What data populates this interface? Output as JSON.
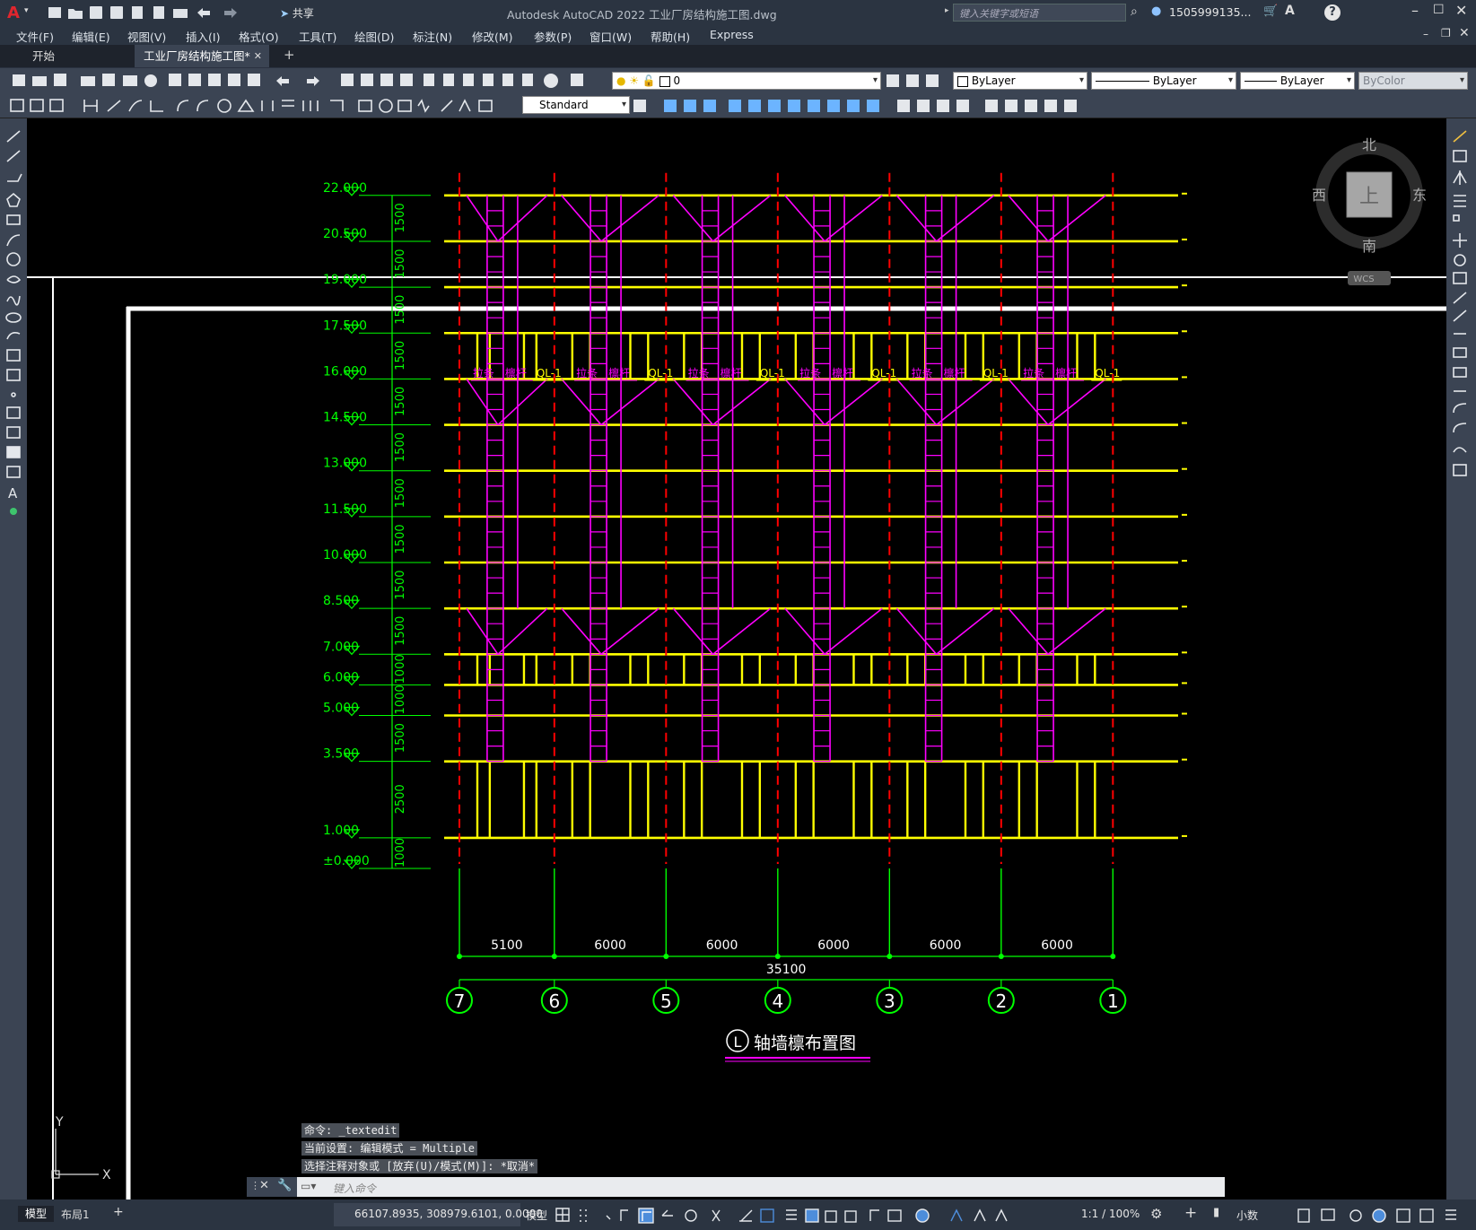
{
  "window": {
    "title": "Autodesk AutoCAD 2022    工业厂房结构施工图.dwg",
    "share_label": "共享",
    "search_placeholder": "键入关键字或短语",
    "user": "1505999135...",
    "help": "?"
  },
  "menu": [
    "文件(F)",
    "编辑(E)",
    "视图(V)",
    "插入(I)",
    "格式(O)",
    "工具(T)",
    "绘图(D)",
    "标注(N)",
    "修改(M)",
    "参数(P)",
    "窗口(W)",
    "帮助(H)",
    "Express"
  ],
  "tabs": {
    "start": "开始",
    "active": "工业厂房结构施工图*",
    "close": "✕",
    "add": "+"
  },
  "layer": {
    "value": "0"
  },
  "properties": {
    "color": "ByLayer",
    "linetype": "ByLayer",
    "lineweight": "ByLayer",
    "plotstyle": "ByColor"
  },
  "style": {
    "value": "Standard"
  },
  "viewcube": {
    "north": "北",
    "south": "南",
    "east": "东",
    "west": "西",
    "top": "上",
    "wcs": "WCS"
  },
  "drawing": {
    "title": "轴墙檩布置图",
    "title_circle": "L",
    "header_labels": [
      "拉条",
      "檩杆",
      "QL-1"
    ],
    "elevations": [
      "22.000",
      "20.500",
      "19.000",
      "17.500",
      "16.000",
      "14.500",
      "13.000",
      "11.500",
      "10.000",
      "8.500",
      "7.000",
      "6.000",
      "5.000",
      "3.500",
      "1.000",
      "±0.000"
    ],
    "spacing_labels": [
      "1500",
      "1500",
      "1500",
      "1500",
      "1500",
      "1500",
      "1500",
      "1500",
      "1500",
      "1500",
      "1000",
      "1000",
      "1500",
      "2500",
      "1000"
    ],
    "spans": [
      "5100",
      "6000",
      "6000",
      "6000",
      "6000",
      "6000"
    ],
    "total_span": "35100",
    "axes": [
      "7",
      "6",
      "5",
      "4",
      "3",
      "2",
      "1"
    ]
  },
  "ucs": {
    "y": "Y",
    "x": "X"
  },
  "command": {
    "history": [
      "命令: _textedit",
      "当前设置: 编辑模式 = Multiple",
      "选择注释对象或 [放弃(U)/模式(M)]: *取消*"
    ],
    "placeholder": "键入命令"
  },
  "status": {
    "model_tab": "模型",
    "layout_tab": "布局1",
    "add": "+",
    "coords": "66107.8935, 308979.6101, 0.0000",
    "space": "模型",
    "scale": "1:1 / 100%",
    "units": "小数"
  },
  "colors": {
    "yellow": "#ffff00",
    "magenta": "#ff00ff",
    "green": "#00ff00",
    "red": "#ff0000",
    "chrome": "#2b3441"
  }
}
